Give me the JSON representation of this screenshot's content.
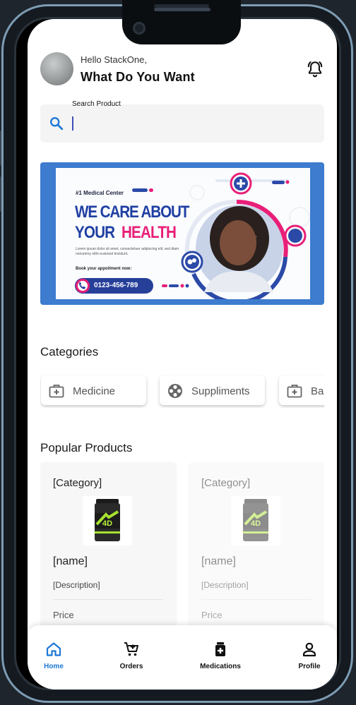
{
  "header": {
    "greeting": "Hello StackOne,",
    "headline": "What Do You Want"
  },
  "search": {
    "label": "Search Product",
    "value": ""
  },
  "banner": {
    "tag": "#1 Medical Center",
    "headline_line1": "WE CARE ABOUT",
    "headline_line2_a": "YOUR",
    "headline_line2_b": "HEALTH",
    "description": "Lorem ipsum dolor sit amet, consectetuer adipiscing elit, sed diam nonummy nibh euismod tincidunt.",
    "booking_label": "Book your appoitment now:",
    "phone": "0123-456-789"
  },
  "categories": {
    "title": "Categories",
    "items": [
      {
        "label": "Medicine",
        "icon": "medical-kit-icon"
      },
      {
        "label": "Suppliments",
        "icon": "supplement-wheel-icon"
      },
      {
        "label": "Bal",
        "icon": "medical-kit-icon"
      }
    ]
  },
  "popular": {
    "title": "Popular Products",
    "products": [
      {
        "category": "[Category]",
        "name": "[name]",
        "description": "[Description]",
        "price": "Price"
      },
      {
        "category": "[Category]",
        "name": "[name]",
        "description": "[Description]",
        "price": "Price"
      }
    ]
  },
  "nav": {
    "items": [
      {
        "label": "Home",
        "icon": "home-icon",
        "active": true
      },
      {
        "label": "Orders",
        "icon": "cart-add-icon",
        "active": false
      },
      {
        "label": "Medications",
        "icon": "medicine-bottle-icon",
        "active": false
      },
      {
        "label": "Profile",
        "icon": "person-icon",
        "active": false
      }
    ]
  },
  "colors": {
    "accent": "#1e78d6",
    "banner_blue": "#3d7ccf",
    "banner_pink": "#e81f78",
    "banner_navy": "#1f3fa2"
  }
}
